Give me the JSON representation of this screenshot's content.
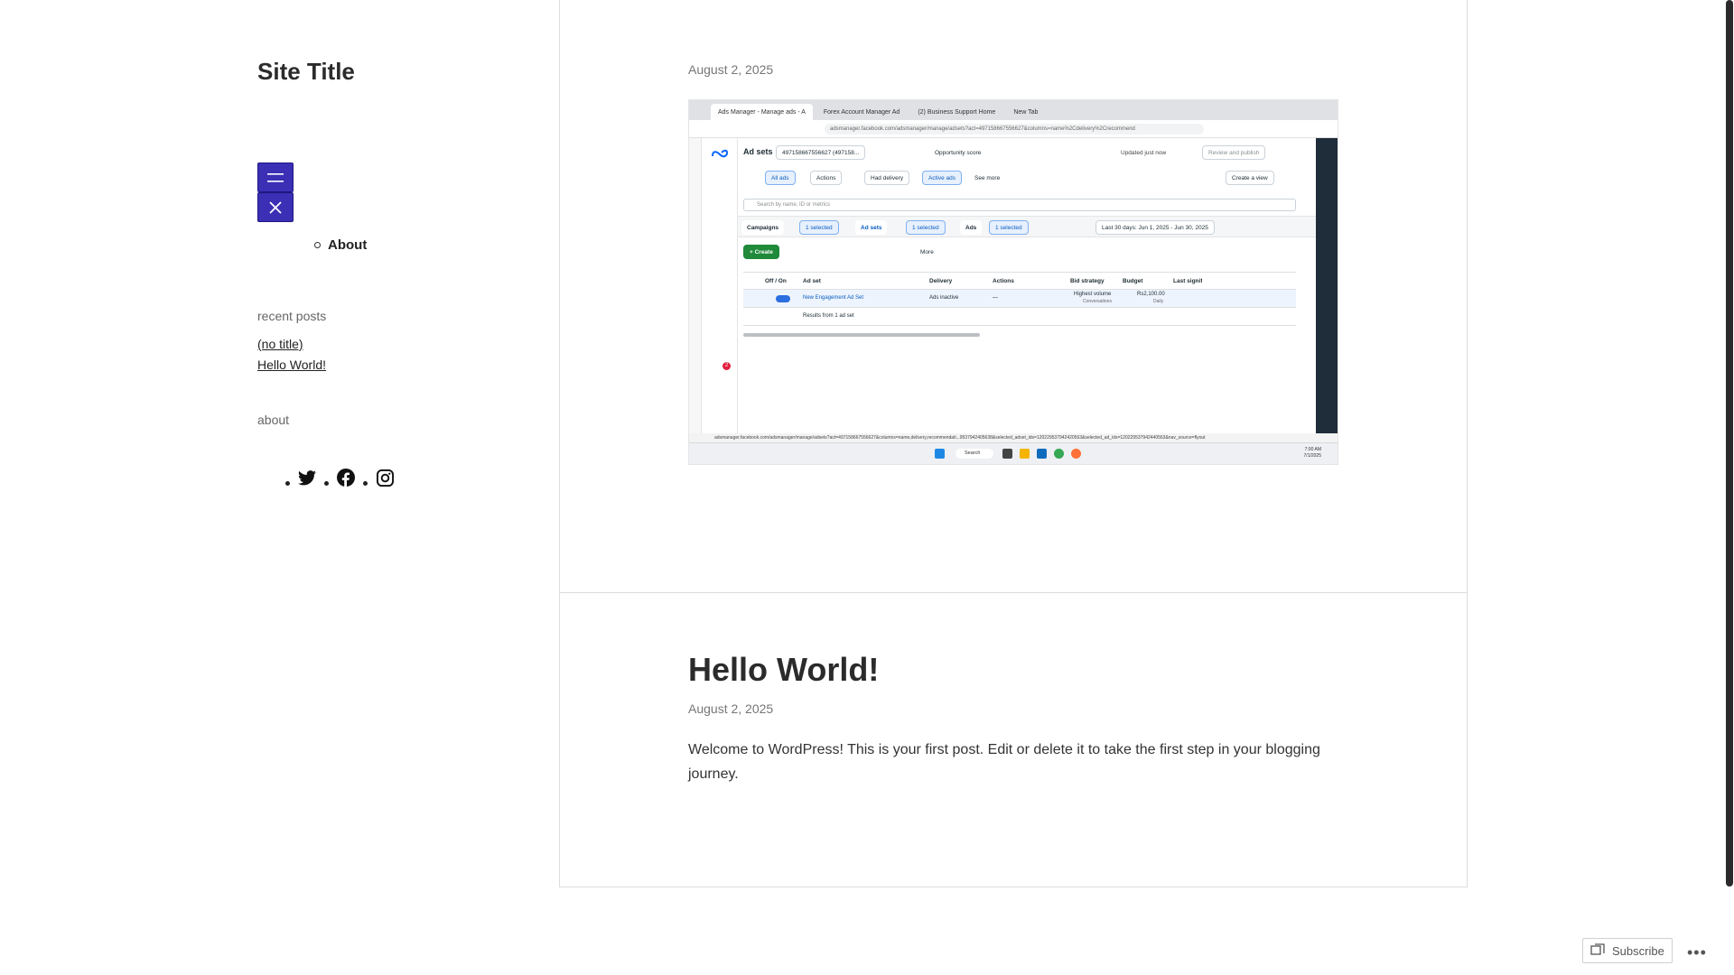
{
  "site": {
    "title": "Site Title"
  },
  "nav": {
    "items": [
      {
        "label": "About"
      }
    ]
  },
  "sidebar": {
    "recent_posts_title": "recent posts",
    "recent_posts": [
      {
        "label": "(no title)"
      },
      {
        "label": "Hello World!"
      }
    ],
    "about_title": "about",
    "social_icons": [
      "twitter-icon",
      "facebook-icon",
      "instagram-icon"
    ]
  },
  "posts": [
    {
      "date": "August 2, 2025",
      "image": {
        "tabs": [
          "Ads Manager - Manage ads - A",
          "Forex Account Manager Ad",
          "(2) Business Support Home",
          "New Tab"
        ],
        "url": "adsmanager.facebook.com/adsmanager/manage/adsets?act=497158667556627&columns=name%2Cdelivery%2Crecommend",
        "header": "Ad sets",
        "account": "497158667556627 (497158...",
        "opportunity": "Opportunity score",
        "updated": "Updated just now",
        "review": "Review and publish",
        "filters": [
          "All ads",
          "Actions",
          "Had delivery",
          "Active ads",
          "See more"
        ],
        "create_view": "Create a view",
        "search_placeholder": "Search by name, ID or metrics",
        "level_tabs": [
          "Campaigns",
          "Ad sets",
          "Ads"
        ],
        "selected_badge": "1 selected",
        "date_range": "Last 30 days: Jun 1, 2025 - Jun 30, 2025",
        "create": "+ Create",
        "more": "More",
        "columns": [
          "Off / On",
          "Ad set",
          "Delivery",
          "Actions",
          "Bid strategy",
          "Budget",
          "Last significant edit"
        ],
        "row": {
          "name": "New Engagement Ad Set",
          "delivery": "Ads inactive",
          "actions": "—",
          "bid": "Highest volume",
          "bid_sub": "Conversations",
          "budget": "Rs2,100.00",
          "budget_sub": "Daily"
        },
        "results": "Results from 1 ad set",
        "status_url": "adsmanager.facebook.com/adsmanager/manage/adsets?act=497158667556627&columns=name,delivery,recommendati...9537942405638&selected_adset_ids=120229537942420563&selected_ad_ids=120229537942440563&nav_source=flyout",
        "taskbar_search": "Search",
        "clock_time": "7:00 AM",
        "clock_date": "7/1/2025",
        "badge_count": "2"
      }
    },
    {
      "title": "Hello World!",
      "date": "August 2, 2025",
      "body": "Welcome to WordPress! This is your first post. Edit or delete it to take the first step in your blogging journey."
    }
  ],
  "footer": {
    "subscribe": "Subscribe",
    "more": "•••"
  },
  "colors": {
    "accent": "#3b2fb5",
    "text": "#333333",
    "muted": "#767676",
    "border": "#dddddd"
  }
}
